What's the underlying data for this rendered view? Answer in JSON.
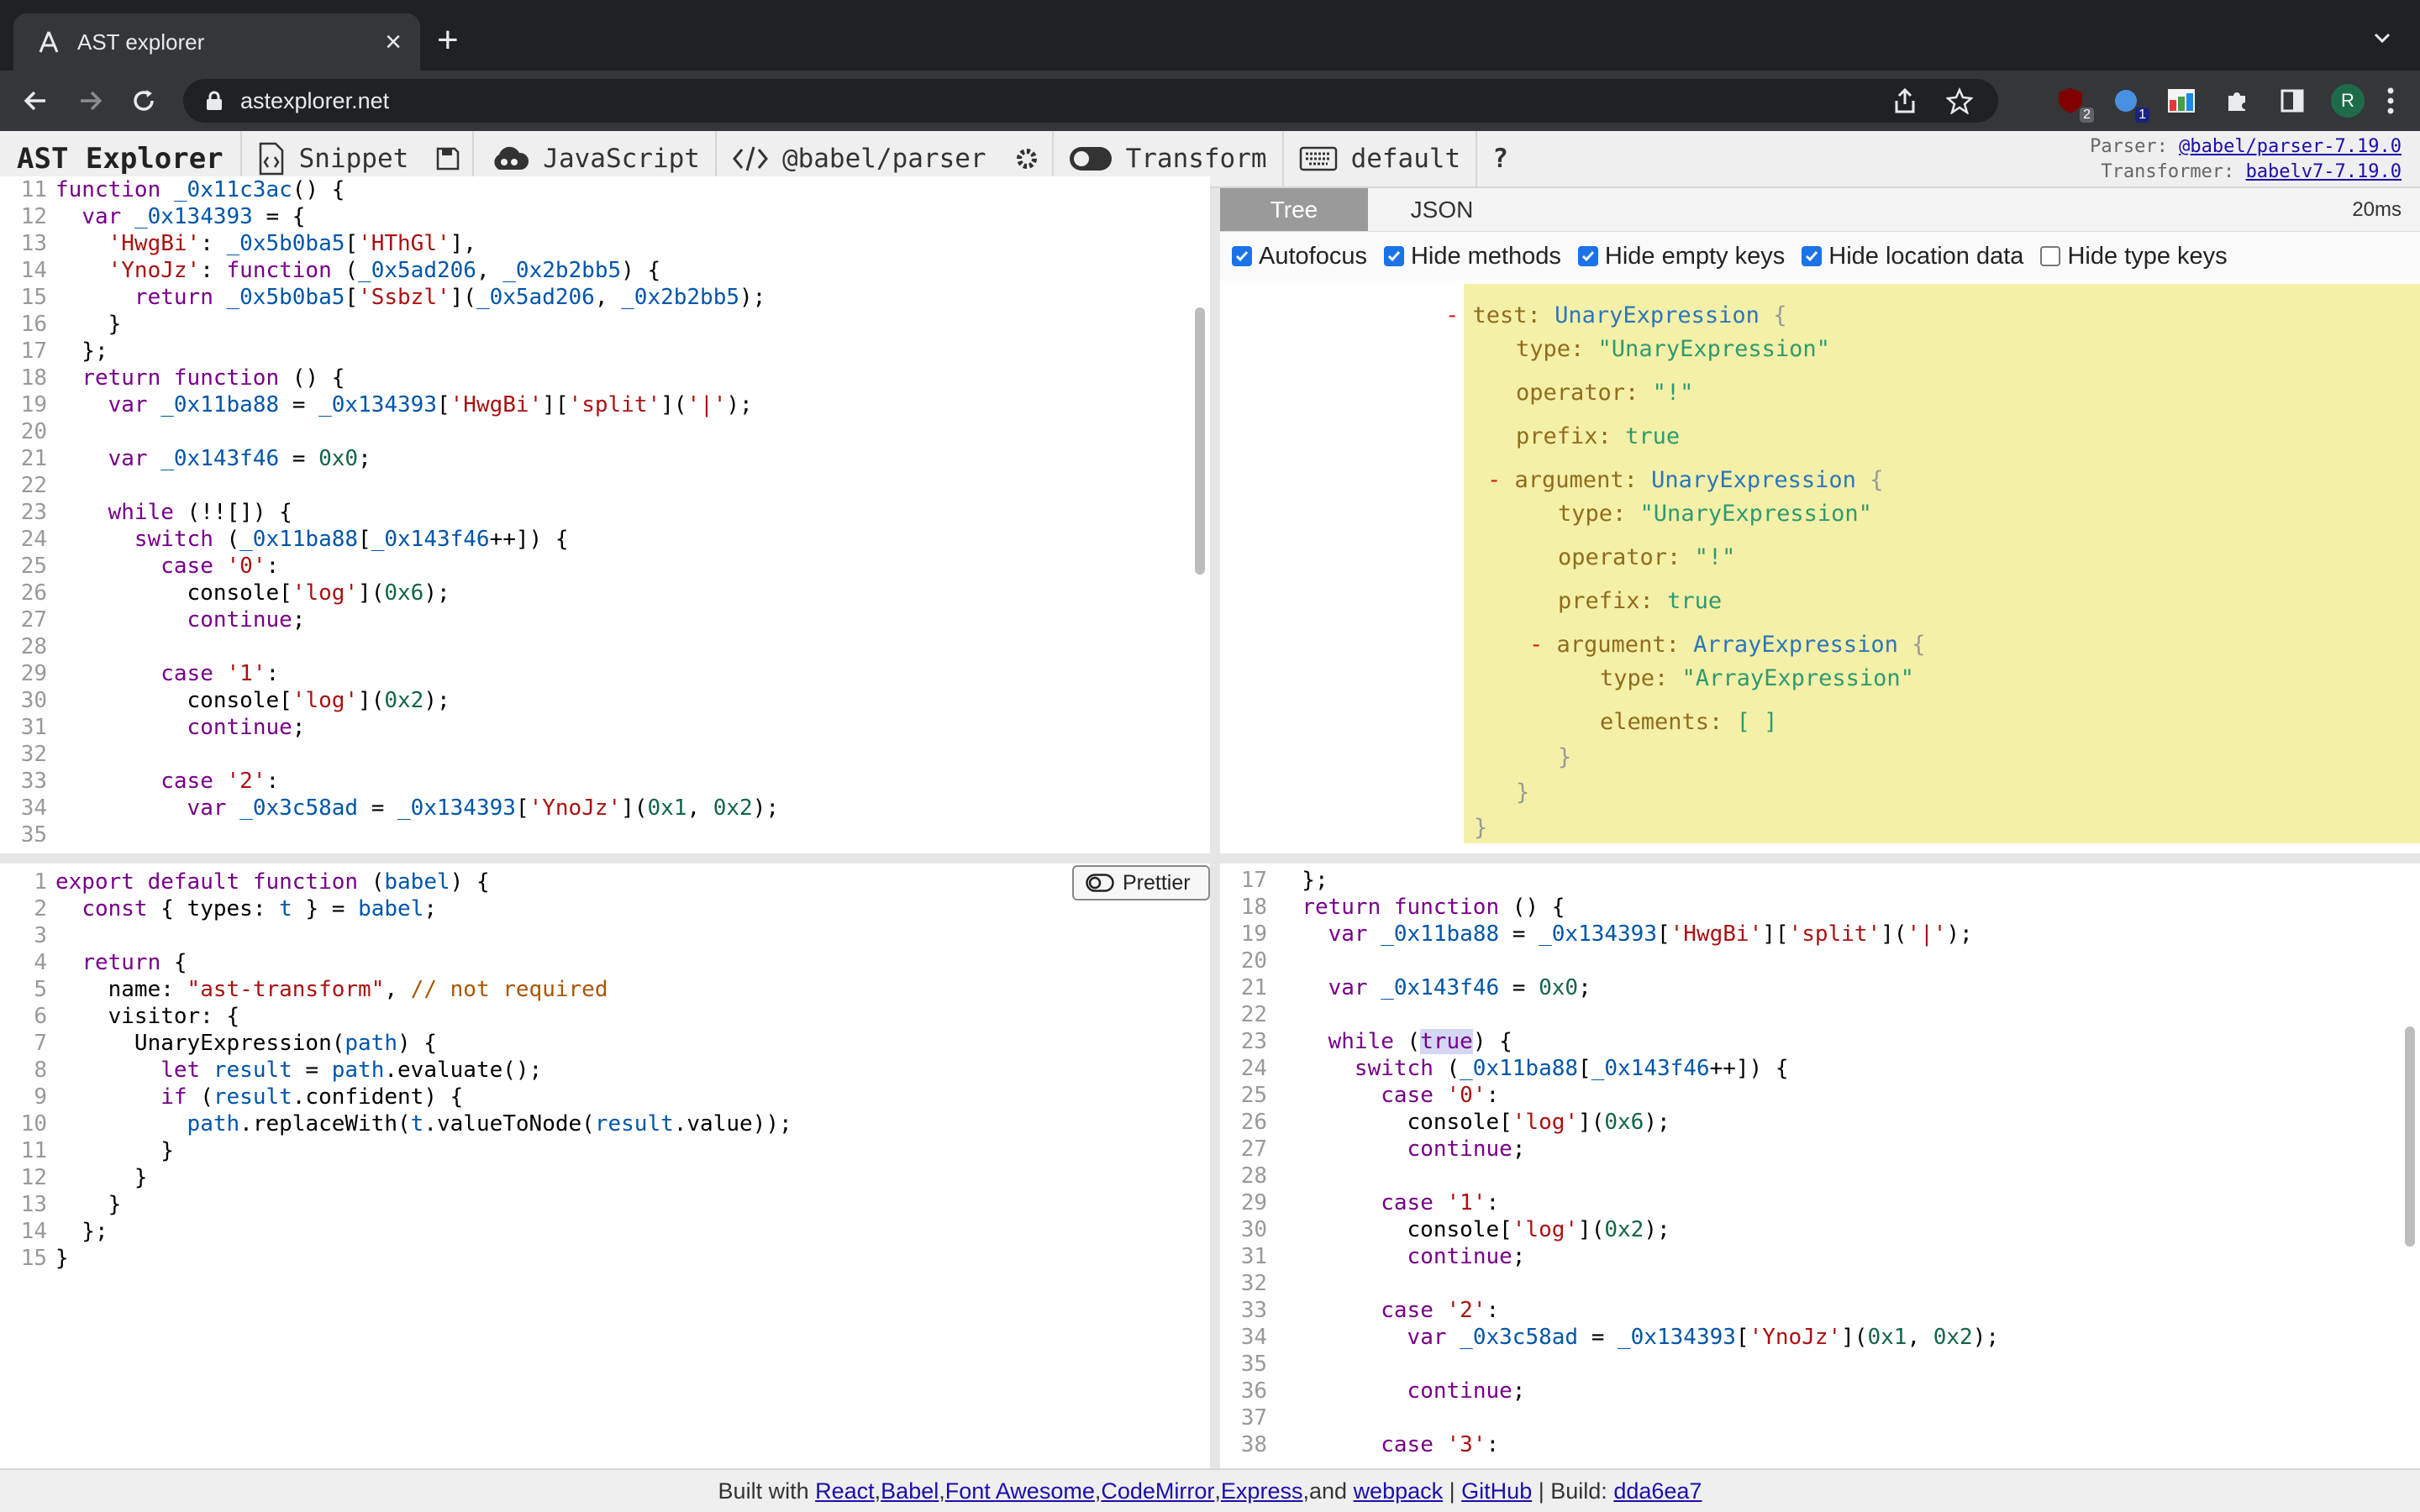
{
  "browser": {
    "tab_title": "AST explorer",
    "url": "astexplorer.net",
    "ext_badges": [
      "2",
      "1"
    ],
    "profile_initial": "R"
  },
  "toolbar": {
    "brand": "AST Explorer",
    "snippet": "Snippet",
    "language": "JavaScript",
    "parser": "@babel/parser",
    "transform": "Transform",
    "keymap": "default",
    "help": "?",
    "parser_label": "Parser:",
    "parser_version": "@babel/parser-7.19.0",
    "transformer_label": "Transformer:",
    "transformer_version": "babelv7-7.19.0"
  },
  "tree": {
    "tabs": [
      "Tree",
      "JSON"
    ],
    "timing": "20ms",
    "options": [
      {
        "label": "Autofocus",
        "checked": true
      },
      {
        "label": "Hide methods",
        "checked": true
      },
      {
        "label": "Hide empty keys",
        "checked": true
      },
      {
        "label": "Hide location data",
        "checked": true
      },
      {
        "label": "Hide type keys",
        "checked": false
      }
    ],
    "nodes": [
      {
        "minus": "-",
        "key": "test:",
        "type": "UnaryExpression",
        "brace": "{"
      },
      {
        "key": "type:",
        "value": "\"UnaryExpression\""
      },
      {
        "key": "operator:",
        "value": "\"!\""
      },
      {
        "key": "prefix:",
        "value": "true"
      },
      {
        "minus": "-",
        "key": "argument:",
        "type": "UnaryExpression",
        "brace": "{"
      },
      {
        "key": "type:",
        "value": "\"UnaryExpression\""
      },
      {
        "key": "operator:",
        "value": "\"!\""
      },
      {
        "key": "prefix:",
        "value": "true"
      },
      {
        "minus": "-",
        "key": "argument:",
        "type": "ArrayExpression",
        "brace": "{"
      },
      {
        "key": "type:",
        "value": "\"ArrayExpression\""
      },
      {
        "key": "elements:",
        "value": "[ ]"
      },
      {
        "brace": "}"
      },
      {
        "brace": "}"
      },
      {
        "brace": "}"
      }
    ]
  },
  "prettier_label": "Prettier",
  "footer": {
    "prefix": "Built with",
    "links": [
      "React",
      "Babel",
      "Font Awesome",
      "CodeMirror",
      "Express"
    ],
    "and": "and",
    "webpack": "webpack",
    "github": "GitHub",
    "build_label": "Build:",
    "build": "dda6ea7"
  },
  "source_code": [
    {
      "n": "11",
      "code": "function _0x11c3ac() {"
    },
    {
      "n": "12",
      "code": "  var _0x134393 = {"
    },
    {
      "n": "13",
      "code": "    'HwgBi': _0x5b0ba5['HThGl'],"
    },
    {
      "n": "14",
      "code": "    'YnoJz': function (_0x5ad206, _0x2b2bb5) {"
    },
    {
      "n": "15",
      "code": "      return _0x5b0ba5['Ssbzl'](_0x5ad206, _0x2b2bb5);"
    },
    {
      "n": "16",
      "code": "    }"
    },
    {
      "n": "17",
      "code": "  };"
    },
    {
      "n": "18",
      "code": "  return function () {"
    },
    {
      "n": "19",
      "code": "    var _0x11ba88 = _0x134393['HwgBi']['split']('|');"
    },
    {
      "n": "20",
      "code": ""
    },
    {
      "n": "21",
      "code": "    var _0x143f46 = 0x0;"
    },
    {
      "n": "22",
      "code": ""
    },
    {
      "n": "23",
      "code": "    while (!![]) {"
    },
    {
      "n": "24",
      "code": "      switch (_0x11ba88[_0x143f46++]) {"
    },
    {
      "n": "25",
      "code": "        case '0':"
    },
    {
      "n": "26",
      "code": "          console['log'](0x6);"
    },
    {
      "n": "27",
      "code": "          continue;"
    },
    {
      "n": "28",
      "code": ""
    },
    {
      "n": "29",
      "code": "        case '1':"
    },
    {
      "n": "30",
      "code": "          console['log'](0x2);"
    },
    {
      "n": "31",
      "code": "          continue;"
    },
    {
      "n": "32",
      "code": ""
    },
    {
      "n": "33",
      "code": "        case '2':"
    },
    {
      "n": "34",
      "code": "          var _0x3c58ad = _0x134393['YnoJz'](0x1, 0x2);"
    },
    {
      "n": "35",
      "code": ""
    }
  ],
  "transform_code": [
    {
      "n": "1",
      "code": "export default function (babel) {"
    },
    {
      "n": "2",
      "code": "  const { types: t } = babel;"
    },
    {
      "n": "3",
      "code": ""
    },
    {
      "n": "4",
      "code": "  return {"
    },
    {
      "n": "5",
      "code": "    name: \"ast-transform\", // not required"
    },
    {
      "n": "6",
      "code": "    visitor: {"
    },
    {
      "n": "7",
      "code": "      UnaryExpression(path) {"
    },
    {
      "n": "8",
      "code": "        let result = path.evaluate();"
    },
    {
      "n": "9",
      "code": "        if (result.confident) {"
    },
    {
      "n": "10",
      "code": "          path.replaceWith(t.valueToNode(result.value));"
    },
    {
      "n": "11",
      "code": "        }"
    },
    {
      "n": "12",
      "code": "      }"
    },
    {
      "n": "13",
      "code": "    }"
    },
    {
      "n": "14",
      "code": "  };"
    },
    {
      "n": "15",
      "code": "}"
    }
  ],
  "output_code": [
    {
      "n": "17",
      "code": "  };"
    },
    {
      "n": "18",
      "code": "  return function () {"
    },
    {
      "n": "19",
      "code": "    var _0x11ba88 = _0x134393['HwgBi']['split']('|');"
    },
    {
      "n": "20",
      "code": ""
    },
    {
      "n": "21",
      "code": "    var _0x143f46 = 0x0;"
    },
    {
      "n": "22",
      "code": ""
    },
    {
      "n": "23",
      "code": "    while (true) {"
    },
    {
      "n": "24",
      "code": "      switch (_0x11ba88[_0x143f46++]) {"
    },
    {
      "n": "25",
      "code": "        case '0':"
    },
    {
      "n": "26",
      "code": "          console['log'](0x6);"
    },
    {
      "n": "27",
      "code": "          continue;"
    },
    {
      "n": "28",
      "code": ""
    },
    {
      "n": "29",
      "code": "        case '1':"
    },
    {
      "n": "30",
      "code": "          console['log'](0x2);"
    },
    {
      "n": "31",
      "code": "          continue;"
    },
    {
      "n": "32",
      "code": ""
    },
    {
      "n": "33",
      "code": "        case '2':"
    },
    {
      "n": "34",
      "code": "          var _0x3c58ad = _0x134393['YnoJz'](0x1, 0x2);"
    },
    {
      "n": "35",
      "code": ""
    },
    {
      "n": "36",
      "code": "          continue;"
    },
    {
      "n": "37",
      "code": ""
    },
    {
      "n": "38",
      "code": "        case '3':"
    }
  ]
}
